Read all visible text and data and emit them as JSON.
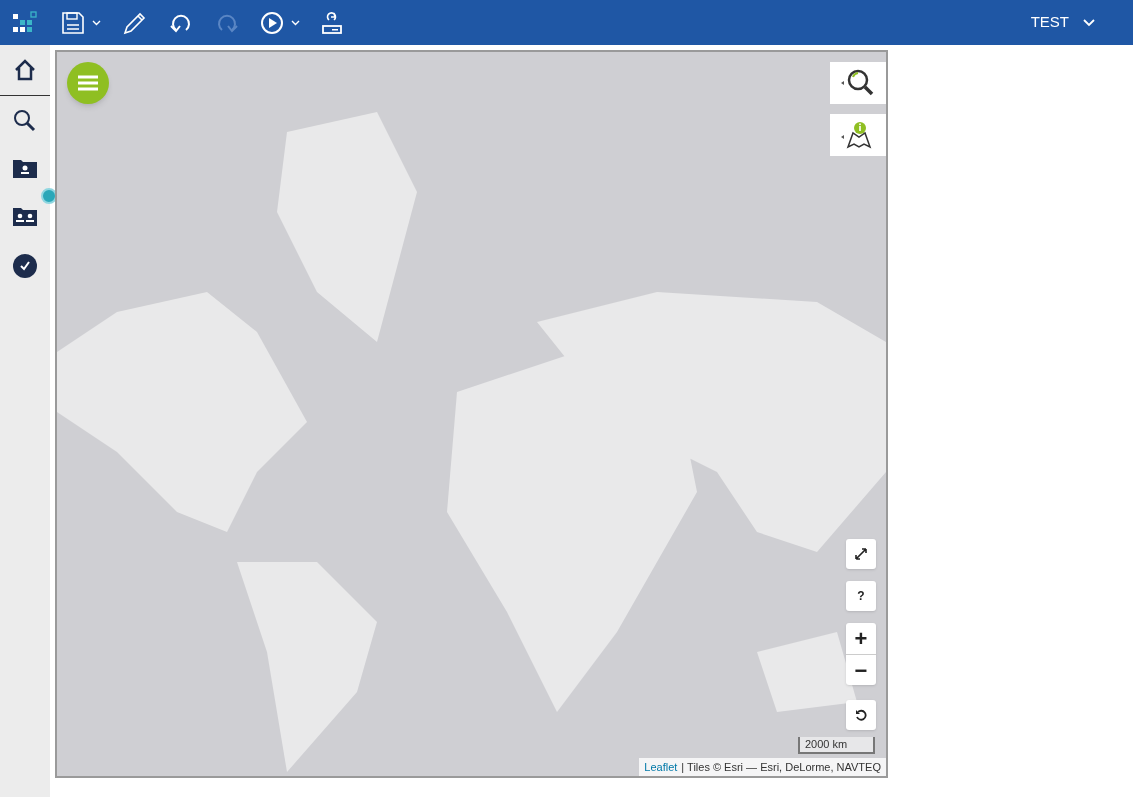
{
  "toolbar": {
    "buttons": [
      {
        "kind": "save",
        "disabled": false
      },
      {
        "kind": "edit",
        "disabled": false
      },
      {
        "kind": "undo",
        "disabled": false
      },
      {
        "kind": "redo",
        "disabled": true
      },
      {
        "kind": "run",
        "disabled": false
      },
      {
        "kind": "export",
        "disabled": false
      }
    ],
    "user": "TEST"
  },
  "map": {
    "controls": [
      {
        "kind": "fullscreen"
      },
      {
        "kind": "text",
        "label": "?"
      },
      {
        "kind": "zoom",
        "labels": [
          "+",
          "−"
        ]
      },
      {
        "kind": "reset"
      }
    ],
    "scale": "2000 km",
    "attribution": {
      "link": "Leaflet",
      "text": "| Tiles © Esri — Esri, DeLorme, NAVTEQ"
    }
  }
}
